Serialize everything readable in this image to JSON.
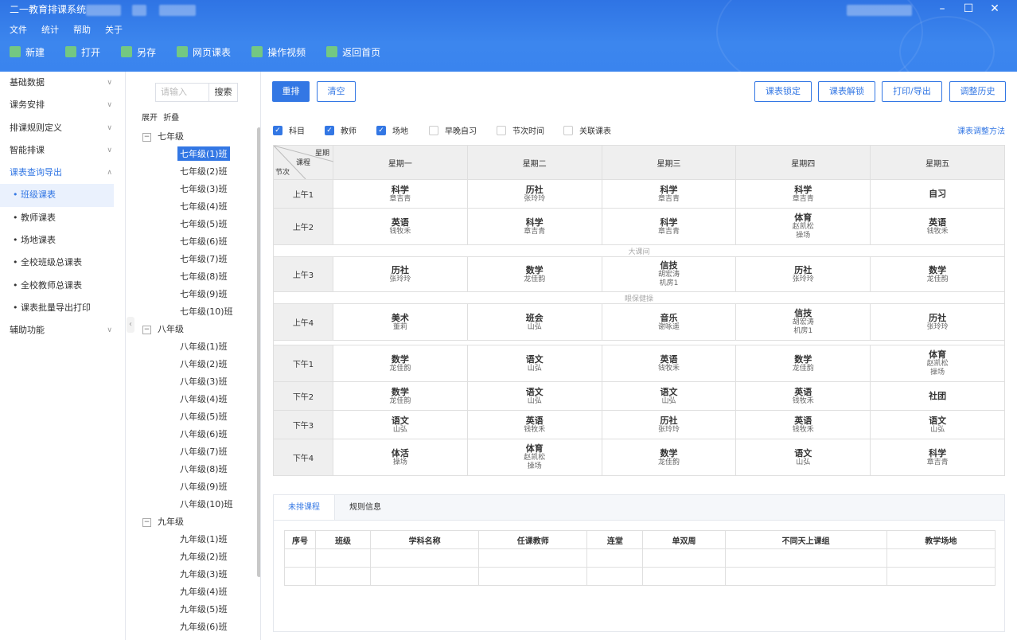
{
  "app": {
    "title": "二一教育排课系统",
    "menu": [
      "文件",
      "统计",
      "帮助",
      "关于"
    ],
    "toolbar": [
      {
        "label": "新建",
        "icon": "new-file-icon",
        "color": "#7ed36f"
      },
      {
        "label": "打开",
        "icon": "folder-open-icon",
        "color": "#7ed36f"
      },
      {
        "label": "另存",
        "icon": "save-as-icon",
        "color": "#7ed36f"
      },
      {
        "label": "网页课表",
        "icon": "web-schedule-icon",
        "color": "#7ed36f"
      },
      {
        "label": "操作视频",
        "icon": "video-icon",
        "color": "#7ed36f"
      },
      {
        "label": "返回首页",
        "icon": "back-home-icon",
        "color": "#7ed36f"
      }
    ]
  },
  "sidebar": {
    "items": [
      "基础数据",
      "课务安排",
      "排课规则定义",
      "智能排课",
      "课表查询导出"
    ],
    "subitems": [
      "班级课表",
      "教师课表",
      "场地课表",
      "全校班级总课表",
      "全校教师总课表",
      "课表批量导出打印"
    ],
    "last": "辅助功能"
  },
  "tree": {
    "search_placeholder": "请输入",
    "search_btn": "搜索",
    "expand": "展开",
    "fold": "折叠",
    "grades": [
      {
        "name": "七年级",
        "classes": [
          "七年级(1)班",
          "七年级(2)班",
          "七年级(3)班",
          "七年级(4)班",
          "七年级(5)班",
          "七年级(6)班",
          "七年级(7)班",
          "七年级(8)班",
          "七年级(9)班",
          "七年级(10)班"
        ]
      },
      {
        "name": "八年级",
        "classes": [
          "八年级(1)班",
          "八年级(2)班",
          "八年级(3)班",
          "八年级(4)班",
          "八年级(5)班",
          "八年级(6)班",
          "八年级(7)班",
          "八年级(8)班",
          "八年级(9)班",
          "八年级(10)班"
        ]
      },
      {
        "name": "九年级",
        "classes": [
          "九年级(1)班",
          "九年级(2)班",
          "九年级(3)班",
          "九年级(4)班",
          "九年级(5)班",
          "九年级(6)班"
        ]
      }
    ]
  },
  "actions": {
    "rearrange": "重排",
    "clear": "清空",
    "lock": "课表锁定",
    "unlock": "课表解锁",
    "print": "打印/导出",
    "history": "调整历史"
  },
  "checks": [
    {
      "label": "科目",
      "on": true
    },
    {
      "label": "教师",
      "on": true
    },
    {
      "label": "场地",
      "on": true
    },
    {
      "label": "早晚自习",
      "on": false
    },
    {
      "label": "节次时间",
      "on": false
    },
    {
      "label": "关联课表",
      "on": false
    }
  ],
  "adjust_link": "课表调整方法",
  "schedule": {
    "corner": {
      "week": "星期",
      "course": "课程",
      "period": "节次"
    },
    "days": [
      "星期一",
      "星期二",
      "星期三",
      "星期四",
      "星期五"
    ],
    "rows": [
      {
        "type": "p",
        "label": "上午1",
        "cells": [
          [
            "科学",
            "章吉青"
          ],
          [
            "历社",
            "张玲玲"
          ],
          [
            "科学",
            "章吉青"
          ],
          [
            "科学",
            "章吉青"
          ],
          [
            "自习"
          ]
        ]
      },
      {
        "type": "p",
        "label": "上午2",
        "cells": [
          [
            "英语",
            "钱牧禾"
          ],
          [
            "科学",
            "章吉青"
          ],
          [
            "科学",
            "章吉青"
          ],
          [
            "体育",
            "赵凯松",
            "操场"
          ],
          [
            "英语",
            "钱牧禾"
          ]
        ]
      },
      {
        "type": "b",
        "label": "大课间"
      },
      {
        "type": "p",
        "label": "上午3",
        "cells": [
          [
            "历社",
            "张玲玲"
          ],
          [
            "数学",
            "龙佳韵"
          ],
          [
            "信技",
            "胡宏涛",
            "机房1"
          ],
          [
            "历社",
            "张玲玲"
          ],
          [
            "数学",
            "龙佳韵"
          ]
        ]
      },
      {
        "type": "b",
        "label": "眼保健操"
      },
      {
        "type": "p",
        "label": "上午4",
        "cells": [
          [
            "美术",
            "董莉"
          ],
          [
            "班会",
            "山弘"
          ],
          [
            "音乐",
            "谢咏遥"
          ],
          [
            "信技",
            "胡宏涛",
            "机房1"
          ],
          [
            "历社",
            "张玲玲"
          ]
        ]
      },
      {
        "type": "g"
      },
      {
        "type": "p",
        "label": "下午1",
        "cells": [
          [
            "数学",
            "龙佳韵"
          ],
          [
            "语文",
            "山弘"
          ],
          [
            "英语",
            "钱牧禾"
          ],
          [
            "数学",
            "龙佳韵"
          ],
          [
            "体育",
            "赵凯松",
            "操场"
          ]
        ]
      },
      {
        "type": "p",
        "label": "下午2",
        "cells": [
          [
            "数学",
            "龙佳韵"
          ],
          [
            "语文",
            "山弘"
          ],
          [
            "语文",
            "山弘"
          ],
          [
            "英语",
            "钱牧禾"
          ],
          [
            "社团"
          ]
        ]
      },
      {
        "type": "p",
        "label": "下午3",
        "cells": [
          [
            "语文",
            "山弘"
          ],
          [
            "英语",
            "钱牧禾"
          ],
          [
            "历社",
            "张玲玲"
          ],
          [
            "英语",
            "钱牧禾"
          ],
          [
            "语文",
            "山弘"
          ]
        ]
      },
      {
        "type": "p",
        "label": "下午4",
        "cells": [
          [
            "体活",
            "操场"
          ],
          [
            "体育",
            "赵凯松",
            "操场"
          ],
          [
            "数学",
            "龙佳韵"
          ],
          [
            "语文",
            "山弘"
          ],
          [
            "科学",
            "章吉青"
          ]
        ]
      }
    ]
  },
  "bottom": {
    "tabs": [
      "未排课程",
      "规则信息"
    ],
    "columns": [
      "序号",
      "班级",
      "学科名称",
      "任课教师",
      "连堂",
      "单双周",
      "不同天上课组",
      "教学场地"
    ]
  }
}
